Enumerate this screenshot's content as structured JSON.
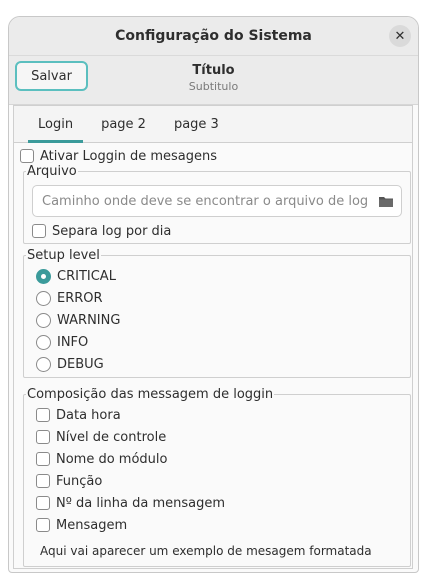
{
  "window": {
    "title": "Configuração do Sistema"
  },
  "headerbar": {
    "save_label": "Salvar",
    "title": "Título",
    "subtitle": "Subtitulo"
  },
  "tabs": [
    {
      "label": "Login",
      "active": true
    },
    {
      "label": "page 2",
      "active": false
    },
    {
      "label": "page 3",
      "active": false
    }
  ],
  "login": {
    "enable_logging_label": "Ativar Loggin de mesagens",
    "enable_logging_checked": false,
    "file_group": {
      "legend": "Arquivo",
      "path_placeholder": "Caminho onde deve se encontrar o arquivo de log",
      "split_by_day_label": "Separa log  por dia",
      "split_by_day_checked": false
    },
    "setup_level": {
      "legend": "Setup level",
      "options": [
        {
          "label": "CRITICAL",
          "checked": true
        },
        {
          "label": "ERROR",
          "checked": false
        },
        {
          "label": "WARNING",
          "checked": false
        },
        {
          "label": "INFO",
          "checked": false
        },
        {
          "label": "DEBUG",
          "checked": false
        }
      ]
    },
    "composition": {
      "legend": "Composição das messagem de loggin",
      "options": [
        {
          "label": "Data hora",
          "checked": false
        },
        {
          "label": "Nível de controle",
          "checked": false
        },
        {
          "label": "Nome do módulo",
          "checked": false
        },
        {
          "label": "Função",
          "checked": false
        },
        {
          "label": "Nº da linha da mensagem",
          "checked": false
        },
        {
          "label": "Mensagem",
          "checked": false
        }
      ],
      "example_text": "Aqui vai aparecer um exemplo de mesagem formatada"
    }
  },
  "colors": {
    "accent": "#3b9b9b",
    "save_border": "#5bbfbf"
  },
  "icons": {
    "close": "close-icon",
    "folder": "folder-icon"
  }
}
